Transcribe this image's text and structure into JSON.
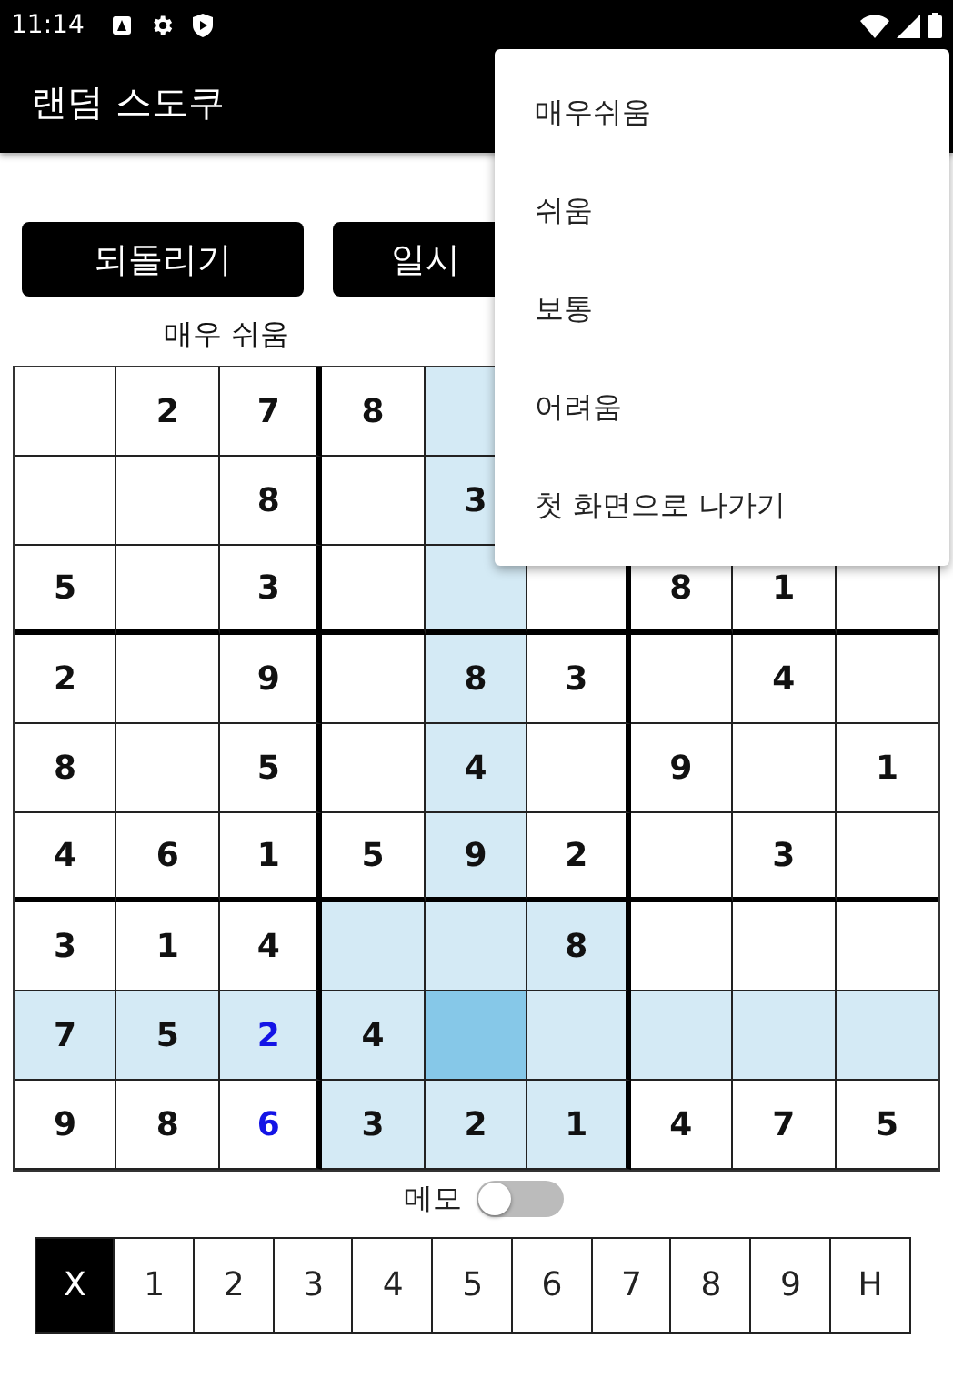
{
  "status_bar": {
    "time": "11:14"
  },
  "app_bar": {
    "title": "랜덤 스도쿠"
  },
  "buttons": [
    {
      "label": "되돌리기"
    },
    {
      "label": "일시"
    }
  ],
  "difficulty_label": "매우 쉬움",
  "grid": {
    "rows": [
      [
        {
          "highlighted": false,
          "selected": false
        },
        {
          "value": "2",
          "highlighted": false,
          "selected": false,
          "user_entered": false
        },
        {
          "value": "7",
          "highlighted": false,
          "selected": false,
          "user_entered": false
        },
        {
          "value": "8",
          "highlighted": false,
          "selected": false,
          "user_entered": false
        },
        {
          "highlighted": true,
          "selected": false
        }
      ],
      [
        {
          "highlighted": false,
          "selected": false
        },
        {
          "highlighted": false,
          "selected": false
        },
        {
          "value": "8",
          "highlighted": false,
          "selected": false,
          "user_entered": false
        },
        {
          "highlighted": false,
          "selected": false
        },
        {
          "value": "3",
          "highlighted": true,
          "selected": false,
          "user_entered": false
        }
      ],
      [
        {
          "value": "5",
          "highlighted": false,
          "selected": false,
          "user_entered": false
        },
        {
          "highlighted": false,
          "selected": false
        },
        {
          "value": "3",
          "highlighted": false,
          "selected": false,
          "user_entered": false
        },
        {
          "highlighted": false,
          "selected": false
        },
        {
          "highlighted": true,
          "selected": false
        },
        {
          "highlighted": false,
          "selected": false
        },
        {
          "value": "8",
          "highlighted": false,
          "selected": false,
          "user_entered": false
        },
        {
          "value": "1",
          "highlighted": false,
          "selected": false,
          "user_entered": false
        },
        {
          "highlighted": false,
          "selected": false
        }
      ],
      [
        {
          "value": "2",
          "highlighted": false,
          "selected": false,
          "user_entered": false
        },
        {
          "highlighted": false,
          "selected": false
        },
        {
          "value": "9",
          "highlighted": false,
          "selected": false,
          "user_entered": false
        },
        {
          "highlighted": false,
          "selected": false
        },
        {
          "value": "8",
          "highlighted": true,
          "selected": false,
          "user_entered": false
        },
        {
          "value": "3",
          "highlighted": false,
          "selected": false,
          "user_entered": false
        },
        {
          "highlighted": false,
          "selected": false
        },
        {
          "value": "4",
          "highlighted": false,
          "selected": false,
          "user_entered": false
        },
        {
          "highlighted": false,
          "selected": false
        }
      ],
      [
        {
          "value": "8",
          "highlighted": false,
          "selected": false,
          "user_entered": false
        },
        {
          "highlighted": false,
          "selected": false
        },
        {
          "value": "5",
          "highlighted": false,
          "selected": false,
          "user_entered": false
        },
        {
          "highlighted": false,
          "selected": false
        },
        {
          "value": "4",
          "highlighted": true,
          "selected": false,
          "user_entered": false
        },
        {
          "highlighted": false,
          "selected": false
        },
        {
          "value": "9",
          "highlighted": false,
          "selected": false,
          "user_entered": false
        },
        {
          "highlighted": false,
          "selected": false
        },
        {
          "value": "1",
          "highlighted": false,
          "selected": false,
          "user_entered": false
        }
      ],
      [
        {
          "value": "4",
          "highlighted": false,
          "selected": false,
          "user_entered": false
        },
        {
          "value": "6",
          "highlighted": false,
          "selected": false,
          "user_entered": false
        },
        {
          "value": "1",
          "highlighted": false,
          "selected": false,
          "user_entered": false
        },
        {
          "value": "5",
          "highlighted": false,
          "selected": false,
          "user_entered": false
        },
        {
          "value": "9",
          "highlighted": true,
          "selected": false,
          "user_entered": false
        },
        {
          "value": "2",
          "highlighted": false,
          "selected": false,
          "user_entered": false
        },
        {
          "highlighted": false,
          "selected": false
        },
        {
          "value": "3",
          "highlighted": false,
          "selected": false,
          "user_entered": false
        },
        {
          "highlighted": false,
          "selected": false
        }
      ],
      [
        {
          "value": "3",
          "highlighted": false,
          "selected": false,
          "user_entered": false
        },
        {
          "value": "1",
          "highlighted": false,
          "selected": false,
          "user_entered": false
        },
        {
          "value": "4",
          "highlighted": false,
          "selected": false,
          "user_entered": false
        },
        {
          "highlighted": true,
          "selected": false
        },
        {
          "highlighted": true,
          "selected": false
        },
        {
          "value": "8",
          "highlighted": true,
          "selected": false,
          "user_entered": false
        },
        {
          "highlighted": false,
          "selected": false
        },
        {
          "highlighted": false,
          "selected": false
        },
        {
          "highlighted": false,
          "selected": false
        }
      ],
      [
        {
          "value": "7",
          "highlighted": true,
          "selected": false,
          "user_entered": false
        },
        {
          "value": "5",
          "highlighted": true,
          "selected": false,
          "user_entered": false
        },
        {
          "value": "2",
          "highlighted": true,
          "selected": false,
          "user_entered": true
        },
        {
          "value": "4",
          "highlighted": true,
          "selected": false,
          "user_entered": false
        },
        {
          "highlighted": true,
          "selected": true
        },
        {
          "highlighted": true,
          "selected": false
        },
        {
          "highlighted": true,
          "selected": false
        },
        {
          "highlighted": true,
          "selected": false
        },
        {
          "highlighted": true,
          "selected": false
        }
      ],
      [
        {
          "value": "9",
          "highlighted": false,
          "selected": false,
          "user_entered": false
        },
        {
          "value": "8",
          "highlighted": false,
          "selected": false,
          "user_entered": false
        },
        {
          "value": "6",
          "highlighted": false,
          "selected": false,
          "user_entered": true
        },
        {
          "value": "3",
          "highlighted": true,
          "selected": false,
          "user_entered": false
        },
        {
          "value": "2",
          "highlighted": true,
          "selected": false,
          "user_entered": false
        },
        {
          "value": "1",
          "highlighted": true,
          "selected": false,
          "user_entered": false
        },
        {
          "value": "4",
          "highlighted": false,
          "selected": false,
          "user_entered": false
        },
        {
          "value": "7",
          "highlighted": false,
          "selected": false,
          "user_entered": false
        },
        {
          "value": "5",
          "highlighted": false,
          "selected": false,
          "user_entered": false
        }
      ]
    ]
  },
  "memo": {
    "label": "메모",
    "on": false
  },
  "number_pad": [
    {
      "label": "X",
      "selected": true
    },
    {
      "label": "1",
      "selected": false
    },
    {
      "label": "2",
      "selected": false
    },
    {
      "label": "3",
      "selected": false
    },
    {
      "label": "4",
      "selected": false
    },
    {
      "label": "5",
      "selected": false
    },
    {
      "label": "6",
      "selected": false
    },
    {
      "label": "7",
      "selected": false
    },
    {
      "label": "8",
      "selected": false
    },
    {
      "label": "9",
      "selected": false
    },
    {
      "label": "H",
      "selected": false
    }
  ],
  "menu": {
    "items": [
      {
        "label": "매우쉬움"
      },
      {
        "label": "쉬움"
      },
      {
        "label": "보통"
      },
      {
        "label": "어려움"
      },
      {
        "label": "첫 화면으로 나가기"
      }
    ]
  }
}
